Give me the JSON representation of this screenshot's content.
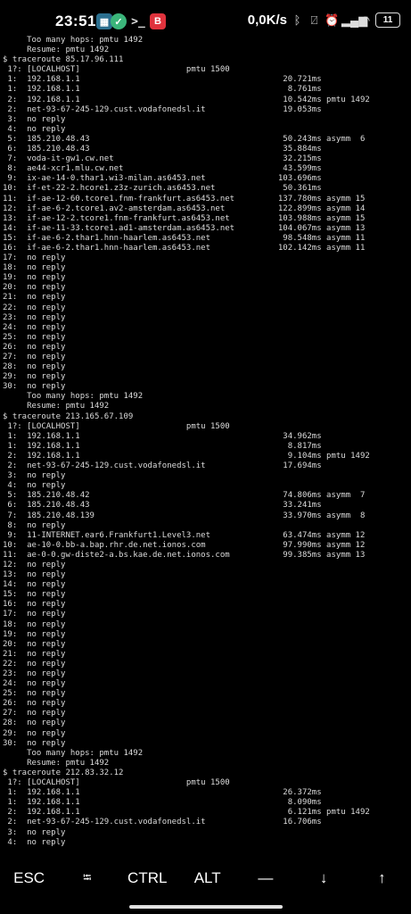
{
  "status_bar": {
    "time": "23:51",
    "apps": [
      "B"
    ],
    "net_speed": "0,0K/s",
    "battery": "11",
    "icons": [
      "bluetooth-icon",
      "vibrate-icon",
      "alarm-icon",
      "wifi-icon",
      "signal-icon"
    ]
  },
  "terminal": {
    "lines": [
      "     Too many hops: pmtu 1492",
      "     Resume: pmtu 1492",
      "$ traceroute 85.17.96.111",
      " 1?: [LOCALHOST]                      pmtu 1500",
      " 1:  192.168.1.1                                          20.721ms",
      " 1:  192.168.1.1                                           8.761ms",
      " 2:  192.168.1.1                                          10.542ms pmtu 1492",
      " 2:  net-93-67-245-129.cust.vodafonedsl.it                19.053ms",
      " 3:  no reply",
      " 4:  no reply",
      " 5:  185.210.48.43                                        50.243ms asymm  6",
      " 6:  185.210.48.43                                        35.884ms",
      " 7:  voda-it-gw1.cw.net                                   32.215ms",
      " 8:  ae44-xcr1.mlu.cw.net                                 43.599ms",
      " 9:  ix-ae-14-0.thar1.wi3-milan.as6453.net               103.696ms",
      "10:  if-et-22-2.hcore1.z3z-zurich.as6453.net              50.361ms",
      "11:  if-ae-12-60.tcore1.fnm-frankfurt.as6453.net         137.780ms asymm 15",
      "12:  if-ae-6-2.tcore1.av2-amsterdam.as6453.net           122.899ms asymm 14",
      "13:  if-ae-12-2.tcore1.fnm-frankfurt.as6453.net          103.988ms asymm 15",
      "14:  if-ae-11-33.tcore1.ad1-amsterdam.as6453.net         104.067ms asymm 13",
      "15:  if-ae-6-2.thar1.hnn-haarlem.as6453.net               98.548ms asymm 11",
      "16:  if-ae-6-2.thar1.hnn-haarlem.as6453.net              102.142ms asymm 11",
      "17:  no reply",
      "18:  no reply",
      "19:  no reply",
      "20:  no reply",
      "21:  no reply",
      "22:  no reply",
      "23:  no reply",
      "24:  no reply",
      "25:  no reply",
      "26:  no reply",
      "27:  no reply",
      "28:  no reply",
      "29:  no reply",
      "30:  no reply",
      "     Too many hops: pmtu 1492",
      "     Resume: pmtu 1492",
      "$ traceroute 213.165.67.109",
      " 1?: [LOCALHOST]                      pmtu 1500",
      " 1:  192.168.1.1                                          34.962ms",
      " 1:  192.168.1.1                                           8.817ms",
      " 2:  192.168.1.1                                           9.104ms pmtu 1492",
      " 2:  net-93-67-245-129.cust.vodafonedsl.it                17.694ms",
      " 3:  no reply",
      " 4:  no reply",
      " 5:  185.210.48.42                                        74.806ms asymm  7",
      " 6:  185.210.48.43                                        33.241ms",
      " 7:  185.210.48.139                                       33.970ms asymm  8",
      " 8:  no reply",
      " 9:  11-INTERNET.ear6.Frankfurt1.Level3.net               63.474ms asymm 12",
      "10:  ae-10-0.bb-a.bap.rhr.de.net.ionos.com                97.990ms asymm 12",
      "11:  ae-0-0.gw-diste2-a.bs.kae.de.net.ionos.com           99.385ms asymm 13",
      "12:  no reply",
      "13:  no reply",
      "14:  no reply",
      "15:  no reply",
      "16:  no reply",
      "17:  no reply",
      "18:  no reply",
      "19:  no reply",
      "20:  no reply",
      "21:  no reply",
      "22:  no reply",
      "23:  no reply",
      "24:  no reply",
      "25:  no reply",
      "26:  no reply",
      "27:  no reply",
      "28:  no reply",
      "29:  no reply",
      "30:  no reply",
      "     Too many hops: pmtu 1492",
      "     Resume: pmtu 1492",
      "$ traceroute 212.83.32.12",
      " 1?: [LOCALHOST]                      pmtu 1500",
      " 1:  192.168.1.1                                          26.372ms",
      " 1:  192.168.1.1                                           8.090ms",
      " 2:  192.168.1.1                                           6.121ms pmtu 1492",
      " 2:  net-93-67-245-129.cust.vodafonedsl.it                16.706ms",
      " 3:  no reply",
      " 4:  no reply"
    ]
  },
  "extra_keys": {
    "esc": "ESC",
    "tab": "⭾",
    "ctrl": "CTRL",
    "alt": "ALT",
    "dash": "—",
    "down": "↓",
    "up": "↑"
  }
}
